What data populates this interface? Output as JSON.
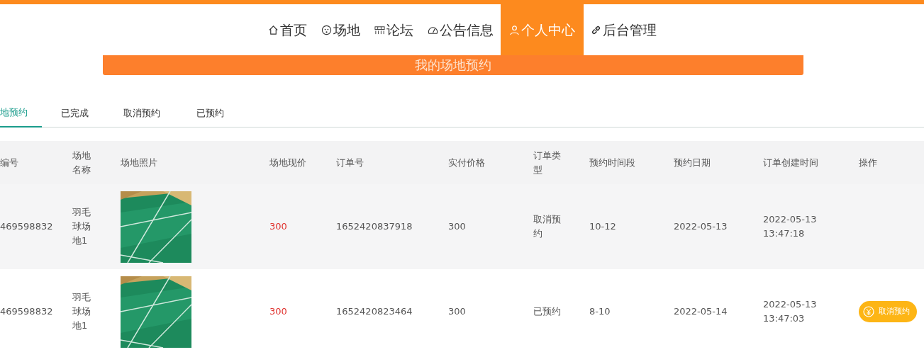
{
  "nav": [
    {
      "kind": "home",
      "label": "首页",
      "selected": false
    },
    {
      "kind": "face",
      "label": "场地",
      "selected": false
    },
    {
      "kind": "grid",
      "label": "论坛",
      "selected": false
    },
    {
      "kind": "gauge",
      "label": "公告信息",
      "selected": false
    },
    {
      "kind": "user",
      "label": "个人中心",
      "selected": true
    },
    {
      "kind": "link",
      "label": "后台管理",
      "selected": false
    }
  ],
  "banner": {
    "title": "我的场地预约"
  },
  "tabs": [
    {
      "label": "地预约",
      "selected": true
    },
    {
      "label": "已完成",
      "selected": false
    },
    {
      "label": "取消预约",
      "selected": false
    },
    {
      "label": "已预约",
      "selected": false
    }
  ],
  "table": {
    "columns": [
      "编号",
      "场地名称",
      "场地照片",
      "场地现价",
      "订单号",
      "实付价格",
      "订单类型",
      "预约时间段",
      "预约日期",
      "订单创建时间",
      "操作"
    ],
    "rows": [
      {
        "id": "469598832",
        "name": "羽毛球场地1",
        "price": "300",
        "order_no": "1652420837918",
        "paid": "300",
        "type": "取消预约",
        "slot": "10-12",
        "date": "2022-05-13",
        "created": "2022-05-13 13:47:18"
      },
      {
        "id": "469598832",
        "name": "羽毛球场地1",
        "price": "300",
        "order_no": "1652420823464",
        "paid": "300",
        "type": "已预约",
        "slot": "8-10",
        "date": "2022-05-14",
        "created": "2022-05-13 13:47:03",
        "action": "取消预约"
      }
    ]
  }
}
